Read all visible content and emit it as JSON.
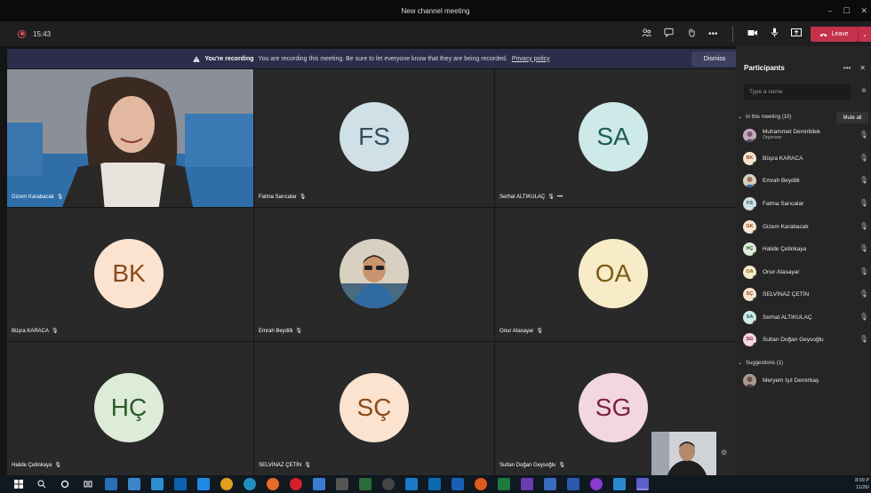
{
  "window": {
    "title": "New channel meeting",
    "minimize": "–",
    "maximize": "☐",
    "close": "✕"
  },
  "toolbar": {
    "timer": "15:43",
    "icons": [
      "participants-icon",
      "chat-icon",
      "raise-hand-icon",
      "more-icon"
    ],
    "more_glyph": "•••",
    "camera_glyph": "■",
    "mic_glyph": "🎙",
    "share_glyph": "⬆",
    "leave_label": "Leave",
    "leave_color": "#c4314b"
  },
  "banner": {
    "strong": "You're recording",
    "text": "You are recording this meeting. Be sure to let everyone know that they are being recorded.",
    "link": "Privacy policy",
    "dismiss": "Dismiss"
  },
  "tiles": [
    {
      "name": "Gizem Karabacak",
      "initials": "",
      "avatar_color": "",
      "text_color": "",
      "video": true
    },
    {
      "name": "Fatma Sarıcalar",
      "initials": "FS",
      "avatar_color": "#cfe0e6",
      "text_color": "#2f4f60",
      "video": false
    },
    {
      "name": "Serhat ALTIKULAÇ",
      "initials": "SA",
      "avatar_color": "#cde9e8",
      "text_color": "#1f5a58",
      "video": false,
      "more": "•••"
    },
    {
      "name": "Büşra KARACA",
      "initials": "BK",
      "avatar_color": "#fbe3d0",
      "text_color": "#8a4a1a",
      "video": false
    },
    {
      "name": "Emrah Beydilli",
      "initials": "",
      "avatar_color": "",
      "text_color": "",
      "video": true,
      "photo": true
    },
    {
      "name": "Onur Atasayar",
      "initials": "OA",
      "avatar_color": "#f7ebc8",
      "text_color": "#7a5b12",
      "video": false
    },
    {
      "name": "Halide Çetinkaya",
      "initials": "HÇ",
      "avatar_color": "#dcecd9",
      "text_color": "#2d5a2a",
      "video": false
    },
    {
      "name": "SELVİNAZ ÇETİN",
      "initials": "SÇ",
      "avatar_color": "#fbe3cf",
      "text_color": "#8a4a1a",
      "video": false
    },
    {
      "name": "Sultan Doğan Geysoğlu",
      "initials": "SG",
      "avatar_color": "#f3d7e0",
      "text_color": "#7a2340",
      "video": false
    }
  ],
  "participants": {
    "title": "Participants",
    "more": "•••",
    "close": "✕",
    "search_placeholder": "Type a name",
    "in_meeting_label": "In this meeting (10)",
    "mute_all": "Mute all",
    "people": [
      {
        "name": "Muhammet Demirbilek",
        "role": "Organizer",
        "initials": "",
        "color": "#b79ab7"
      },
      {
        "name": "Büşra KARACA",
        "initials": "BK",
        "color": "#fbe3d0"
      },
      {
        "name": "Emrah Beydilli",
        "initials": "",
        "color": "#9a8a7a"
      },
      {
        "name": "Fatma Sarıcalar",
        "initials": "FS",
        "color": "#cfe0e6"
      },
      {
        "name": "Gizem Karabacak",
        "initials": "GK",
        "color": "#fbe3d0"
      },
      {
        "name": "Halide Çetinkaya",
        "initials": "HÇ",
        "color": "#dcecd9"
      },
      {
        "name": "Onur Atasayar",
        "initials": "OA",
        "color": "#f7ebc8"
      },
      {
        "name": "SELVİNAZ ÇETİN",
        "initials": "SÇ",
        "color": "#fbe3cf"
      },
      {
        "name": "Serhat ALTIKULAÇ",
        "initials": "SA",
        "color": "#cde9e8"
      },
      {
        "name": "Sultan Doğan Geysoğlu",
        "initials": "SG",
        "color": "#f3d7e0"
      }
    ],
    "suggestions_label": "Suggestions (1)",
    "suggestions": [
      {
        "name": "Meryem Işıl Demirbaş",
        "initials": "",
        "color": "#8a7a7a"
      }
    ]
  },
  "taskbar": {
    "icons": [
      "start-icon",
      "search-icon",
      "cortana-icon",
      "taskview-icon",
      "app-icon",
      "app-icon",
      "app-icon",
      "app-icon",
      "app-icon",
      "chrome-icon",
      "edge-icon",
      "firefox-icon",
      "opera-icon",
      "app-icon",
      "app-icon",
      "app-icon",
      "app-icon",
      "app-icon",
      "app-icon",
      "app-icon",
      "app-icon",
      "app-icon",
      "app-icon",
      "app-icon",
      "app-icon",
      "app-icon",
      "app-icon",
      "teams-icon"
    ],
    "time": "8:09 P",
    "date": "11/26/"
  }
}
